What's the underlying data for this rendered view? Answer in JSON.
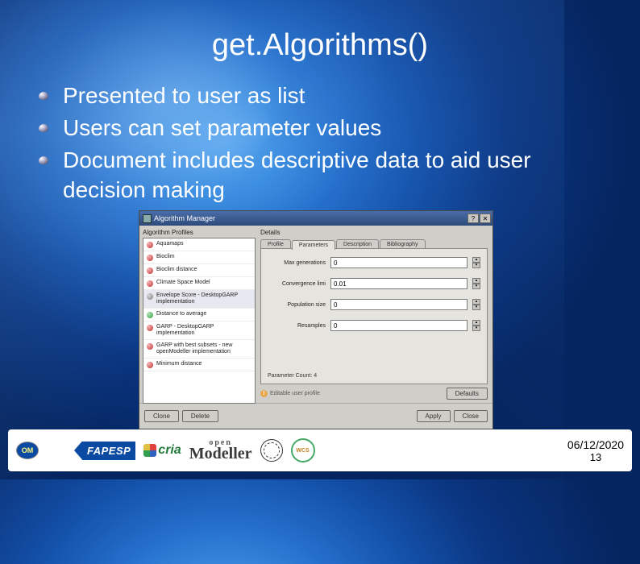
{
  "slide": {
    "title": "get.Algorithms()",
    "bullets": [
      "Presented to user as list",
      "Users can set parameter values",
      "Document includes descriptive data to aid user decision making"
    ],
    "date": "06/12/2020",
    "page": "13"
  },
  "dialog": {
    "title": "Algorithm Manager",
    "close": "✕",
    "help": "?",
    "left_label": "Algorithm Profiles",
    "right_label": "Details",
    "profiles": [
      {
        "name": "Aquamaps",
        "c1": "#f7b5b5",
        "c2": "#c03030"
      },
      {
        "name": "Bioclim",
        "c1": "#f7b5b5",
        "c2": "#c03030"
      },
      {
        "name": "Bioclim distance",
        "c1": "#f7b5b5",
        "c2": "#c03030"
      },
      {
        "name": "Climate Space Model",
        "c1": "#f7b5b5",
        "c2": "#c03030"
      },
      {
        "name": "Envelope Score - DesktopGARP implementation",
        "c1": "#d8d8d8",
        "c2": "#808080"
      },
      {
        "name": "Distance to average",
        "c1": "#b5e0b5",
        "c2": "#30a040"
      },
      {
        "name": "GARP - DesktopGARP implementation",
        "c1": "#f7b5b5",
        "c2": "#c03030"
      },
      {
        "name": "GARP with best subsets - new openModeller implementation",
        "c1": "#f7b5b5",
        "c2": "#c03030"
      },
      {
        "name": "Minimum distance",
        "c1": "#f7b5b5",
        "c2": "#c03030"
      }
    ],
    "tabs": {
      "profile": "Profile",
      "parameters": "Parameters",
      "description": "Description",
      "bibliography": "Bibliography"
    },
    "params": [
      {
        "label": "Max generations",
        "value": "0"
      },
      {
        "label": "Convergence limi",
        "value": "0.01"
      },
      {
        "label": "Population size",
        "value": "0"
      },
      {
        "label": "Resamples",
        "value": "0"
      }
    ],
    "param_count_label": "Parameter Count: 4",
    "editable_note": "Editable user profile",
    "buttons": {
      "clone": "Clone",
      "delete": "Delete",
      "defaults": "Defaults",
      "apply": "Apply",
      "close": "Close"
    }
  },
  "logos": {
    "om": "OM",
    "fapesp": "FAPESP",
    "cria": "cria",
    "modeller_open": "open",
    "modeller": "Modeller",
    "wcs": "WCS"
  }
}
